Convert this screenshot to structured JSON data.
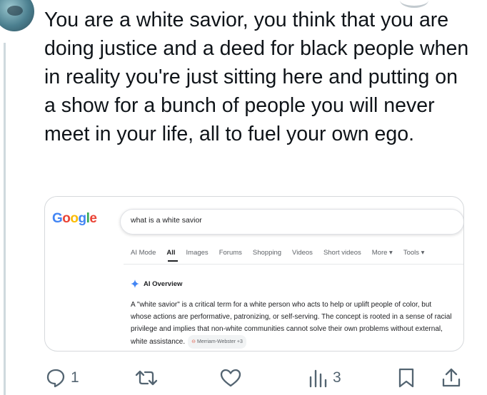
{
  "tweet": {
    "text": "You are a white savior, you think that you are doing justice and a deed for black people when in reality you're just sitting here and putting on a show for a bunch of people you will never meet in your life, all to fuel your own ego."
  },
  "google_card": {
    "logo": {
      "letters": [
        "G",
        "o",
        "o",
        "g",
        "l",
        "e"
      ],
      "colors": [
        "#4285F4",
        "#EA4335",
        "#FBBC05",
        "#4285F4",
        "#34A853",
        "#EA4335"
      ]
    },
    "search_query": "what is a white savior",
    "tabs": [
      "AI Mode",
      "All",
      "Images",
      "Forums",
      "Shopping",
      "Videos",
      "Short videos",
      "More ▾",
      "Tools ▾"
    ],
    "active_tab": "All",
    "ai_overview_label": "AI Overview",
    "ai_overview_text": "A \"white savior\" is a critical term for a white person who acts to help or uplift people of color, but whose actions are performative, patronizing, or self-serving. The concept is rooted in a sense of racial privilege and implies that non-white communities cannot solve their own problems without external, white assistance.",
    "source_chip": "Merriam-Webster +3"
  },
  "actions": {
    "reply_count": "1",
    "views_count": "3",
    "icons": [
      "reply-icon",
      "retweet-icon",
      "like-icon",
      "views-icon",
      "bookmark-icon",
      "share-icon"
    ],
    "icon_color": "#536471"
  }
}
